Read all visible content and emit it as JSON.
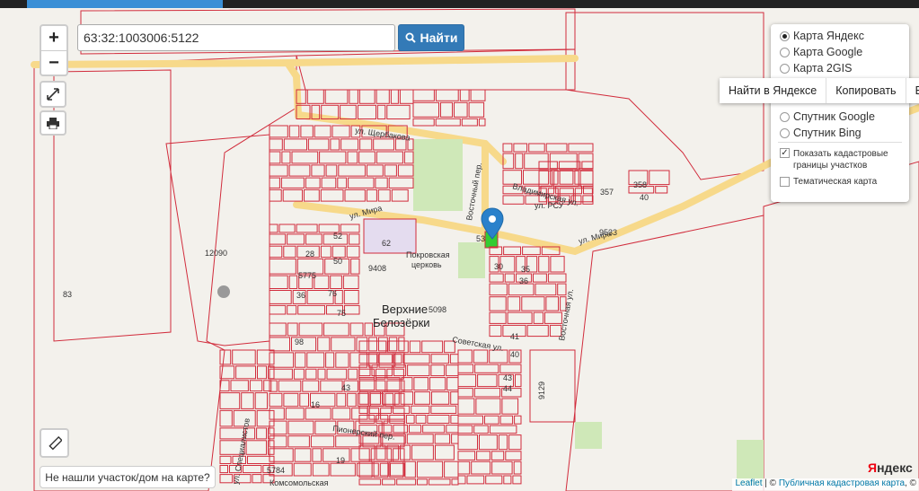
{
  "search": {
    "value": "63:32:1003006:5122",
    "find_label": "Найти"
  },
  "zoom": {
    "in": "+",
    "out": "−"
  },
  "layers": {
    "options": [
      "Карта Яндекс",
      "Карта Google",
      "Карта 2GIS",
      "Спутник Google",
      "Спутник Bing"
    ],
    "selected": "Карта Яндекс",
    "cadastral_label_1": "Показать кадастровые",
    "cadastral_label_2": "границы участков",
    "thematic_label": "Тематическая карта"
  },
  "popup": {
    "find_yandex": "Найти в Яндексе",
    "copy": "Копировать",
    "in_notes": "В зам"
  },
  "not_found": "Не нашли участок/дом на карте?",
  "attribution": {
    "leaflet": "Leaflet",
    "sep": " | © ",
    "pkk": "Публичная кадастровая карта",
    "rest": ", ©"
  },
  "yandex_logo": {
    "y": "Я",
    "rest": "ндекс"
  },
  "map_labels": {
    "village_1": "Верхние",
    "village_2": "Белозёрки",
    "church_1": "Покровская",
    "church_2": "церковь",
    "street_mira": "ул. Мира",
    "street_mira2": "ул. Мира",
    "street_shcherbakova": "ул. Щербакова",
    "street_vladimirskaya": "Владимирская ул.",
    "street_sovetskaya": "Советская ул.",
    "street_pionerskiy": "Пионерский пер.",
    "street_komsomolskaya": "Комсомольская",
    "street_rsu": "ул. РСУ",
    "street_vostochny": "Восточный пер.",
    "street_vostochnaya": "Восточная ул.",
    "street_specialistov": "ул. Специалистов",
    "n12090": "12090",
    "n83": "83",
    "n62": "62",
    "n9408": "9408",
    "n5098": "5098",
    "n5775": "5775",
    "n28": "28",
    "n52": "52",
    "n50": "50",
    "n36": "36",
    "n76": "76",
    "n75": "75",
    "n98": "98",
    "n53": "53",
    "n30": "30",
    "n35": "35",
    "n36b": "36",
    "n41": "41",
    "n40": "40",
    "n43": "43",
    "n44": "44",
    "n9129": "9129",
    "n357": "357",
    "n358": "358",
    "n40b": "40",
    "n9533": "9533",
    "n16": "16",
    "n19": "19",
    "n5784": "5784",
    "n43b": "43"
  },
  "colors": {
    "parcel": "#d12c3c",
    "road": "#f7d98a",
    "green": "#cfe8b8",
    "accent": "#337ab7"
  }
}
